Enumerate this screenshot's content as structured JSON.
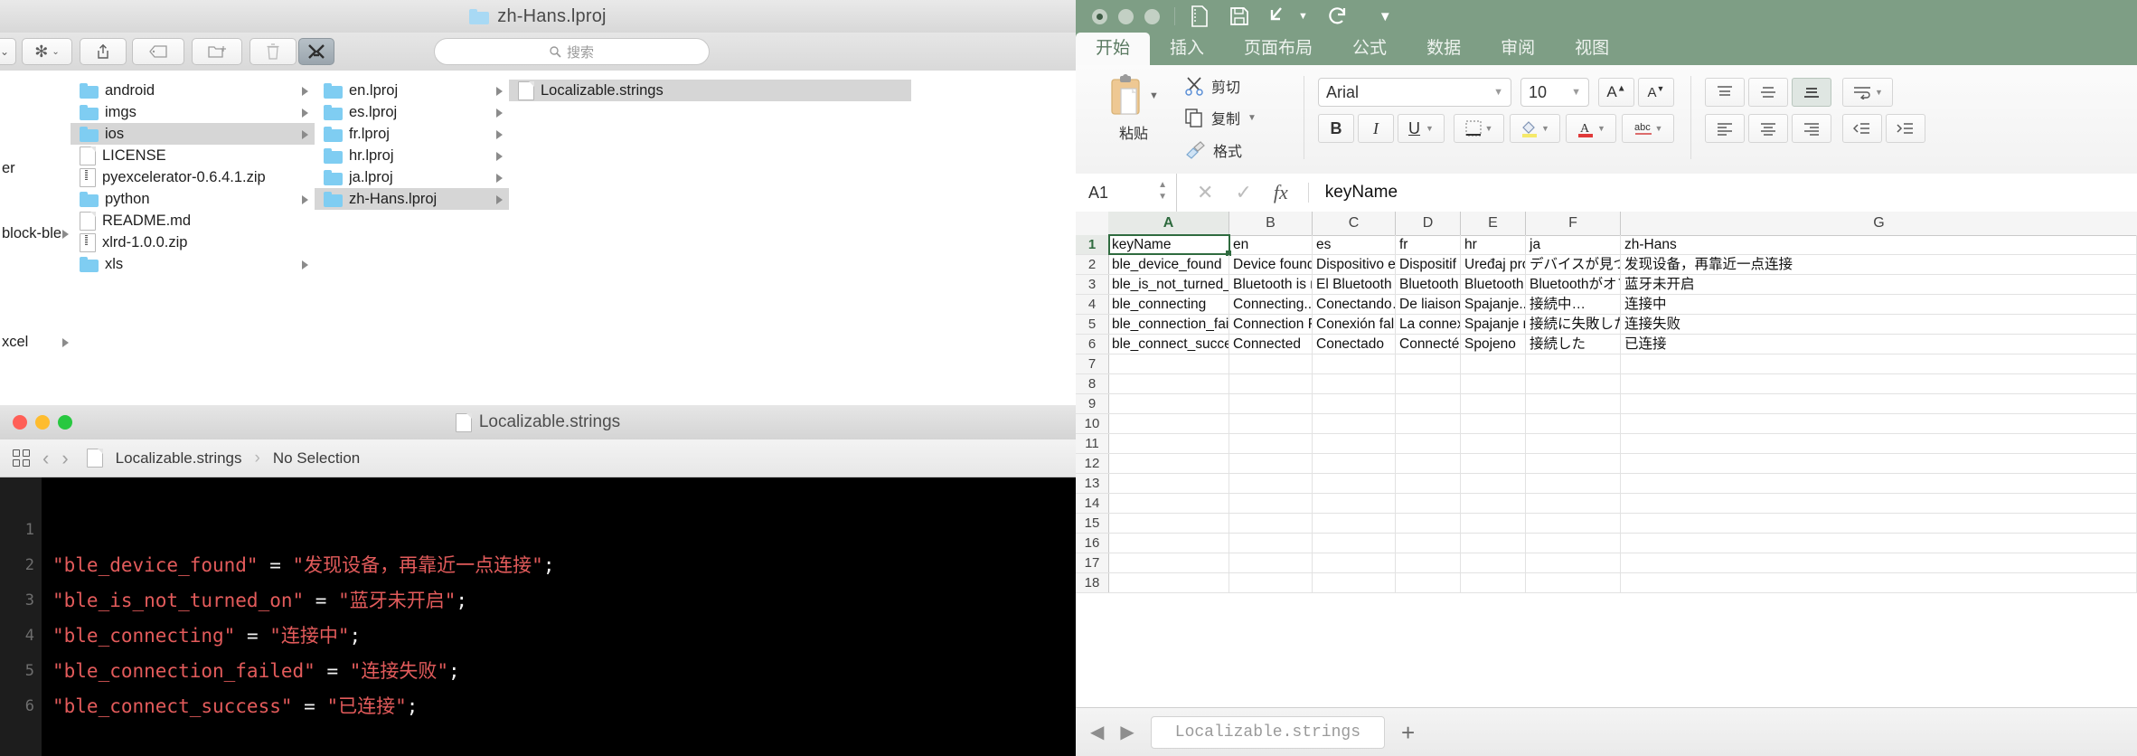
{
  "finder": {
    "title": "zh-Hans.lproj",
    "toolbar": {
      "gear_icon": "gear-icon",
      "share_icon": "share-icon",
      "tag_icon": "tag-icon",
      "newfolder_icon": "new-folder-icon",
      "trash_icon": "trash-icon",
      "xcode_icon": "xcode-app-icon",
      "search_placeholder": "搜索",
      "search_icon": "search-icon"
    },
    "columns": [
      {
        "name": "col-partial-left",
        "items": [
          {
            "label": "er",
            "kind": "partial"
          },
          {
            "label": "block-ble",
            "kind": "partial",
            "chevron": true
          },
          {
            "label": "xcel",
            "kind": "partial",
            "chevron": true
          }
        ]
      },
      {
        "name": "col-project",
        "items": [
          {
            "label": "android",
            "kind": "folder",
            "chevron": true,
            "selected": false
          },
          {
            "label": "imgs",
            "kind": "folder",
            "chevron": true,
            "selected": false
          },
          {
            "label": "ios",
            "kind": "folder",
            "chevron": true,
            "selected": true
          },
          {
            "label": "LICENSE",
            "kind": "doc",
            "chevron": false,
            "selected": false
          },
          {
            "label": "pyexcelerator-0.6.4.1.zip",
            "kind": "zip",
            "chevron": false,
            "selected": false
          },
          {
            "label": "python",
            "kind": "folder",
            "chevron": true,
            "selected": false
          },
          {
            "label": "README.md",
            "kind": "doc",
            "chevron": false,
            "selected": false
          },
          {
            "label": "xlrd-1.0.0.zip",
            "kind": "zip",
            "chevron": false,
            "selected": false
          },
          {
            "label": "xls",
            "kind": "folder",
            "chevron": true,
            "selected": false
          }
        ]
      },
      {
        "name": "col-lproj",
        "items": [
          {
            "label": "en.lproj",
            "kind": "folder",
            "chevron": true,
            "selected": false
          },
          {
            "label": "es.lproj",
            "kind": "folder",
            "chevron": true,
            "selected": false
          },
          {
            "label": "fr.lproj",
            "kind": "folder",
            "chevron": true,
            "selected": false
          },
          {
            "label": "hr.lproj",
            "kind": "folder",
            "chevron": true,
            "selected": false
          },
          {
            "label": "ja.lproj",
            "kind": "folder",
            "chevron": true,
            "selected": false
          },
          {
            "label": "zh-Hans.lproj",
            "kind": "folder",
            "chevron": true,
            "selected": true
          }
        ]
      },
      {
        "name": "col-files",
        "items": [
          {
            "label": "Localizable.strings",
            "kind": "doc",
            "chevron": false,
            "selected": true
          }
        ]
      }
    ]
  },
  "xcode": {
    "window_title": "Localizable.strings",
    "breadcrumb": {
      "file": "Localizable.strings",
      "separator": "›",
      "selection": "No Selection"
    },
    "back_arrow": "‹",
    "forward_arrow": "›",
    "code_lines": [
      {
        "n": "1",
        "key": "\"ble_device_found\"",
        "eq": " = ",
        "value": "\"发现设备，再靠近一点连接\"",
        "semi": ";"
      },
      {
        "n": "2",
        "key": "\"ble_is_not_turned_on\"",
        "eq": " = ",
        "value": "\"蓝牙未开启\"",
        "semi": ";"
      },
      {
        "n": "3",
        "key": "\"ble_connecting\"",
        "eq": " = ",
        "value": "\"连接中\"",
        "semi": ";"
      },
      {
        "n": "4",
        "key": "\"ble_connection_failed\"",
        "eq": " = ",
        "value": "\"连接失败\"",
        "semi": ";"
      },
      {
        "n": "5",
        "key": "\"ble_connect_success\"",
        "eq": " = ",
        "value": "\"已连接\"",
        "semi": ";"
      },
      {
        "n": "6",
        "key": "",
        "eq": "",
        "value": "",
        "semi": ""
      }
    ],
    "colors": {
      "keyword_red": "#e35b5b",
      "background": "#000000",
      "gutter": "#1d1d1d"
    }
  },
  "spreadsheet": {
    "accent_color": "#7e9e85",
    "quick_access": [
      "new-doc-icon",
      "save-icon",
      "undo-icon",
      "undo-caret-icon",
      "redo-icon",
      "customize-caret-icon"
    ],
    "tabs": [
      {
        "label": "开始",
        "active": true
      },
      {
        "label": "插入",
        "active": false
      },
      {
        "label": "页面布局",
        "active": false
      },
      {
        "label": "公式",
        "active": false
      },
      {
        "label": "数据",
        "active": false
      },
      {
        "label": "审阅",
        "active": false
      },
      {
        "label": "视图",
        "active": false
      }
    ],
    "ribbon": {
      "paste_label": "粘贴",
      "paste_icon": "clipboard-icon",
      "cut_label": "剪切",
      "cut_icon": "scissors-icon",
      "copy_label": "复制",
      "copy_icon": "copy-icon",
      "format_label": "格式",
      "format_icon": "format-painter-icon",
      "font_name": "Arial",
      "font_size": "10",
      "grow_font_icon": "increase-font-icon",
      "shrink_font_icon": "decrease-font-icon",
      "bold_label": "B",
      "italic_label": "I",
      "underline_label": "U",
      "borders_icon": "borders-icon",
      "fill_icon": "fill-color-icon",
      "fontcolor_icon": "font-color-icon",
      "clear_icon": "clear-format-icon",
      "align_top_icon": "align-top-icon",
      "align_middle_icon": "align-middle-icon",
      "align_bottom_icon": "align-bottom-icon",
      "wrap_icon": "wrap-text-icon",
      "align_left_icon": "align-left-icon",
      "align_center_icon": "align-center-icon",
      "align_right_icon": "align-right-icon",
      "indent_dec_icon": "decrease-indent-icon",
      "indent_inc_icon": "increase-indent-icon"
    },
    "formula_bar": {
      "name_box": "A1",
      "cancel_icon": "cancel-icon",
      "confirm_icon": "confirm-icon",
      "fx_icon": "fx-icon",
      "value": "keyName"
    },
    "bottom": {
      "prev_icon": "prev-sheet-icon",
      "next_icon": "next-sheet-icon",
      "sheet_name": "Localizable.strings",
      "add_sheet_icon": "add-sheet-icon"
    },
    "grid": {
      "selected_cell": "A1",
      "col_headers": [
        "A",
        "B",
        "C",
        "D",
        "E",
        "F",
        "G"
      ],
      "row_headers": [
        "1",
        "2",
        "3",
        "4",
        "5",
        "6",
        "7",
        "8",
        "9",
        "10",
        "11",
        "12",
        "13",
        "14",
        "15",
        "16",
        "17",
        "18"
      ],
      "rows": [
        [
          "keyName",
          "en",
          "es",
          "fr",
          "hr",
          "ja",
          "zh-Hans"
        ],
        [
          "ble_device_found",
          "Device found. F",
          "Dispositivo en",
          "Dispositif tr",
          "Uređaj pron",
          "デバイスが見つ",
          "发现设备，再靠近一点连接"
        ],
        [
          "ble_is_not_turned_on",
          "Bluetooth is not",
          "El Bluetooth n",
          "Bluetooth e",
          "Bluetooth ni",
          "Bluetoothがオフ",
          "蓝牙未开启"
        ],
        [
          "ble_connecting",
          "Connecting...",
          "Conectando…",
          "De liaison..",
          "Spajanje...",
          "接続中…",
          "连接中"
        ],
        [
          "ble_connection_failed",
          "Connection Fai",
          "Conexión fallid",
          "La connexi",
          "Spajanje ne",
          "接続に失敗した",
          "连接失败"
        ],
        [
          "ble_connect_success",
          "Connected",
          "Conectado",
          "Connecté",
          "Spojeno",
          "接続した",
          "已连接"
        ],
        [
          "",
          "",
          "",
          "",
          "",
          "",
          ""
        ],
        [
          "",
          "",
          "",
          "",
          "",
          "",
          ""
        ],
        [
          "",
          "",
          "",
          "",
          "",
          "",
          ""
        ],
        [
          "",
          "",
          "",
          "",
          "",
          "",
          ""
        ],
        [
          "",
          "",
          "",
          "",
          "",
          "",
          ""
        ],
        [
          "",
          "",
          "",
          "",
          "",
          "",
          ""
        ],
        [
          "",
          "",
          "",
          "",
          "",
          "",
          ""
        ],
        [
          "",
          "",
          "",
          "",
          "",
          "",
          ""
        ],
        [
          "",
          "",
          "",
          "",
          "",
          "",
          ""
        ],
        [
          "",
          "",
          "",
          "",
          "",
          "",
          ""
        ],
        [
          "",
          "",
          "",
          "",
          "",
          "",
          ""
        ],
        [
          "",
          "",
          "",
          "",
          "",
          "",
          ""
        ]
      ]
    }
  }
}
